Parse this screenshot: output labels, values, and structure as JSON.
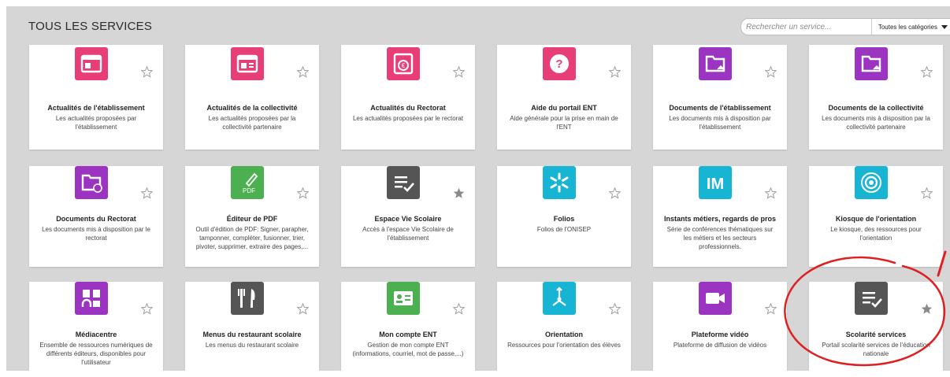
{
  "header": {
    "title": "TOUS LES SERVICES",
    "search_placeholder": "Rechercher un service...",
    "category_label": "Toutes les catégories"
  },
  "colors": {
    "pink": "#e83e77",
    "purple": "#9c34c2",
    "dark": "#555555",
    "green": "#4caf50",
    "cyan": "#17b5d3",
    "star_empty": "#9e9e9e",
    "star_filled": "#8a8a8a",
    "annotation_red": "#e02020"
  },
  "tiles": [
    {
      "title": "Actualités de l'établissement",
      "desc": [
        "Les actualités proposées par",
        "l'établissement"
      ],
      "icon": "news-school-icon",
      "color": "#e83e77",
      "favorite": false
    },
    {
      "title": "Actualités de la collectivité",
      "desc": [
        "Les actualités proposées par la",
        "collectivité partenaire"
      ],
      "icon": "news-collectivity-icon",
      "color": "#e83e77",
      "favorite": false
    },
    {
      "title": "Actualités du Rectorat",
      "desc": [
        "Les actualités proposées par le rectorat"
      ],
      "icon": "news-rectorat-icon",
      "color": "#e83e77",
      "favorite": false
    },
    {
      "title": "Aide du portail ENT",
      "desc": [
        "Aide générale pour la prise en main de",
        "l'ENT"
      ],
      "icon": "help-icon",
      "color": "#e83e77",
      "favorite": false
    },
    {
      "title": "Documents de l'établissement",
      "desc": [
        "Les documents mis à disposition par",
        "l'établissement"
      ],
      "icon": "documents-school-icon",
      "color": "#9c34c2",
      "favorite": false
    },
    {
      "title": "Documents de la collectivité",
      "desc": [
        "Les documents mis à disposition par la",
        "collectivité partenaire"
      ],
      "icon": "documents-collectivity-icon",
      "color": "#9c34c2",
      "favorite": false
    },
    {
      "title": "Documents du Rectorat",
      "desc": [
        "Les documents mis à disposition par le",
        "rectorat"
      ],
      "icon": "documents-rectorat-icon",
      "color": "#9c34c2",
      "favorite": false
    },
    {
      "title": "Éditeur de PDF",
      "desc": [
        "Outil d'édition de PDF: Signer, parapher,",
        "tamponner, compléter, fusionner, trier,",
        "pivoter, supprimer, extraire des pages,..."
      ],
      "icon": "pdf-editor-icon",
      "color": "#4caf50",
      "favorite": false
    },
    {
      "title": "Espace Vie Scolaire",
      "desc": [
        "Accès à l'espace Vie Scolaire de",
        "l'établissement"
      ],
      "icon": "checklist-icon",
      "color": "#555555",
      "favorite": true
    },
    {
      "title": "Folios",
      "desc": [
        "Folios de l'ONISEP"
      ],
      "icon": "folios-icon",
      "color": "#17b5d3",
      "favorite": false
    },
    {
      "title": "Instants métiers, regards de pros",
      "desc": [
        "Série de conférences thématiques sur",
        "les métiers et les secteurs",
        "professionnels."
      ],
      "icon": "im-logo-icon",
      "color": "#17b5d3",
      "favorite": false
    },
    {
      "title": "Kiosque de l'orientation",
      "desc": [
        "Le kiosque, des ressources pour",
        "l'orientation"
      ],
      "icon": "kiosk-icon",
      "color": "#17b5d3",
      "favorite": false
    },
    {
      "title": "Médiacentre",
      "desc": [
        "Ensemble de ressources numériques de",
        "différents éditeurs, disponibles pour",
        "l'utilisateur"
      ],
      "icon": "mediacentre-icon",
      "color": "#9c34c2",
      "favorite": false
    },
    {
      "title": "Menus du restaurant scolaire",
      "desc": [
        "Les menus du restaurant scolaire"
      ],
      "icon": "cutlery-icon",
      "color": "#555555",
      "favorite": false
    },
    {
      "title": "Mon compte ENT",
      "desc": [
        "Gestion de mon compte ENT",
        "(informations, courriel, mot de passe,...)"
      ],
      "icon": "account-card-icon",
      "color": "#4caf50",
      "favorite": false
    },
    {
      "title": "Orientation",
      "desc": [
        "Ressources pour l'orientation des élèves"
      ],
      "icon": "orientation-arrows-icon",
      "color": "#17b5d3",
      "favorite": false
    },
    {
      "title": "Plateforme vidéo",
      "desc": [
        "Plateforme de diffusion de vidéos"
      ],
      "icon": "video-camera-icon",
      "color": "#9c34c2",
      "favorite": false
    },
    {
      "title": "Scolarité services",
      "desc": [
        "Portail scolarité services de l'éducation",
        "nationale"
      ],
      "icon": "checklist-icon",
      "color": "#555555",
      "favorite": true
    }
  ]
}
